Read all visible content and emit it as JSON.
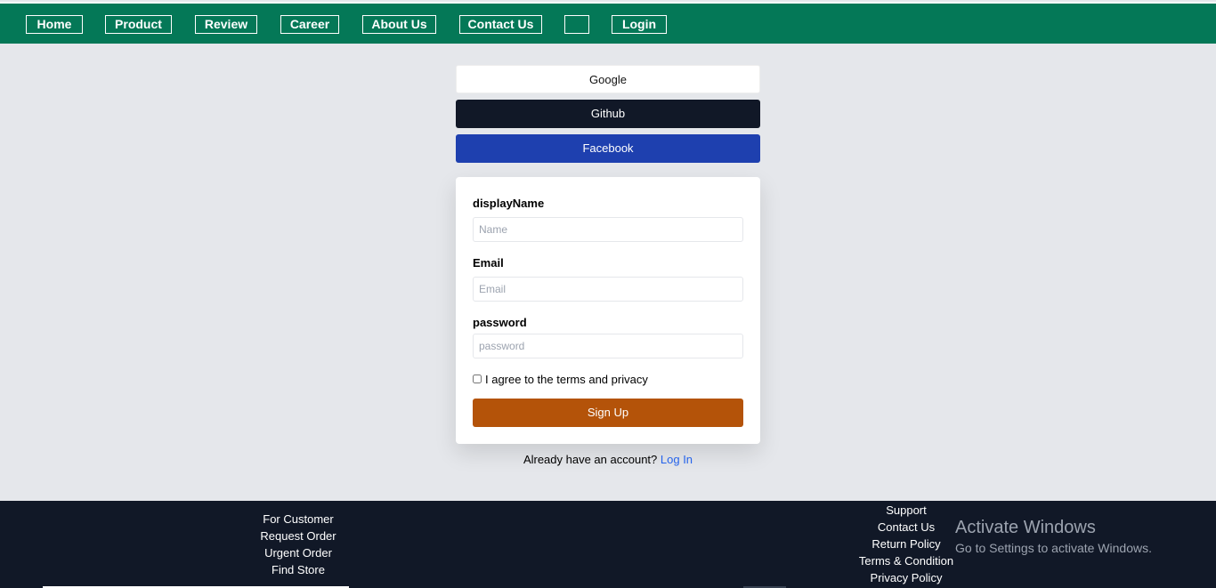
{
  "nav": {
    "home": "Home",
    "product": "Product",
    "review": "Review",
    "career": "Career",
    "about": "About Us",
    "contact": "Contact Us",
    "blank": "",
    "login": "Login"
  },
  "social": {
    "google": "Google",
    "github": "Github",
    "facebook": "Facebook"
  },
  "form": {
    "name_label": "displayName",
    "name_placeholder": "Name",
    "email_label": "Email",
    "email_placeholder": "Email",
    "password_label": "password",
    "password_placeholder": "password",
    "terms": "I agree to the terms and privacy",
    "submit": "Sign Up"
  },
  "login_prompt": {
    "text": "Already have an account?",
    "link": "Log In"
  },
  "footer": {
    "customer": [
      "For Customer",
      "Request Order",
      "Urgent Order",
      "Find Store"
    ],
    "support": [
      "Support",
      "Contact Us",
      "Return Policy",
      "Terms & Condition",
      "Privacy Policy"
    ]
  },
  "watermark": {
    "title": "Activate Windows",
    "subtitle": "Go to Settings to activate Windows."
  }
}
